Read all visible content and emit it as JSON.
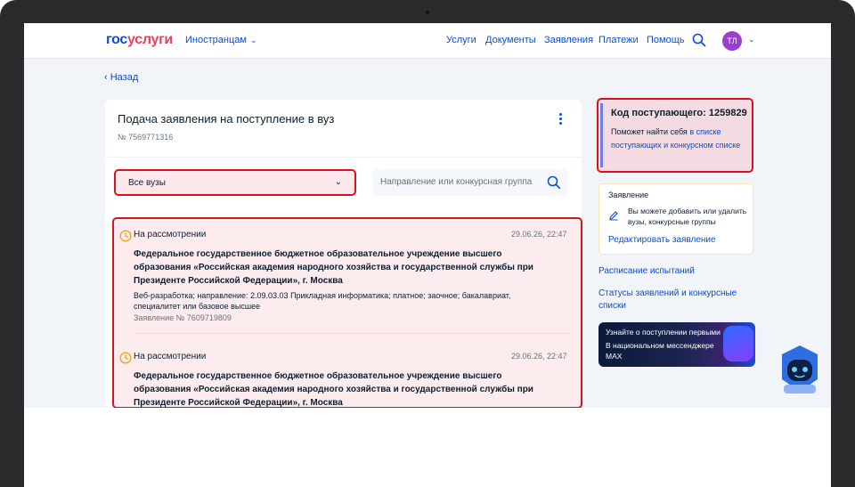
{
  "header": {
    "logo_part1": "гос",
    "logo_part2": "услуги",
    "foreigners": "Иностранцам",
    "nav": [
      "Услуги",
      "Документы",
      "Заявления",
      "Платежи",
      "Помощь"
    ],
    "avatar_initials": "ТЛ"
  },
  "back_label": "Назад",
  "main": {
    "title": "Подача заявления на поступление в вуз",
    "number": "№ 7569771316",
    "select_value": "Все вузы",
    "search_placeholder": "Направление или конкурсная группа",
    "applications": [
      {
        "status": "На рассмотрении",
        "date": "29.06.26, 22:47",
        "org": "Федеральное государственное бюджетное образовательное учреждение высшего образования «Российская академия народного хозяйства и государственной службы при Президенте Российской Федерации», г. Москва",
        "details": "Веб-разработка; направление: 2.09.03.03 Прикладная информатика; платное; заочное; бакалавриат, специалитет или базовое высшее",
        "app_number": "Заявление № 7609719809"
      },
      {
        "status": "На рассмотрении",
        "date": "29.06.26, 22:47",
        "org": "Федеральное государственное бюджетное образовательное учреждение высшего образования «Российская академия народного хозяйства и государственной службы при Президенте Российской Федерации», г. Москва"
      }
    ]
  },
  "sidebar": {
    "code_title": "Код поступающего: 1259829",
    "code_help_text": "Поможет найти себя ",
    "code_help_link": "в списке поступающих и конкурсном списке",
    "app_card_title": "Заявление",
    "app_card_text": "Вы можете добавить или удалить вузы, конкурсные группы",
    "app_card_edit": "Редактировать заявление",
    "link_schedule": "Расписание испытаний",
    "link_statuses": "Статусы заявлений и конкурсные списки",
    "promo_title": "Узнайте о поступлении первыми",
    "promo_text": "В национальном мессенджере MAX"
  }
}
